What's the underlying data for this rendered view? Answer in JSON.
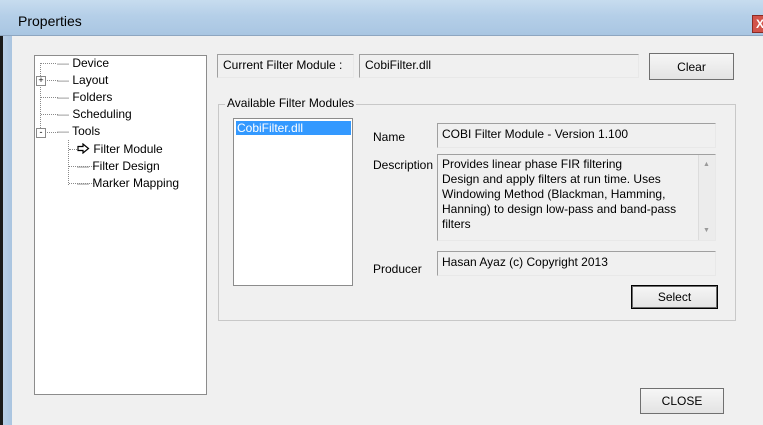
{
  "window": {
    "title": "Properties",
    "close_glyph": "X"
  },
  "tree": {
    "items": [
      {
        "label": "Device"
      },
      {
        "label": "Layout",
        "expander": "+"
      },
      {
        "label": "Folders"
      },
      {
        "label": "Scheduling"
      },
      {
        "label": "Tools",
        "expander": "-"
      },
      {
        "label": "Filter Module",
        "selected_marker": "arrow-right-icon"
      },
      {
        "label": "Filter Design"
      },
      {
        "label": "Marker Mapping"
      }
    ]
  },
  "current_filter": {
    "label": "Current Filter Module :",
    "value": "CobiFilter.dll",
    "clear_button": "Clear"
  },
  "available": {
    "group_title": "Available Filter Modules",
    "modules": [
      "CobiFilter.dll"
    ],
    "name_label": "Name",
    "name_value": "COBI Filter Module  - Version 1.100",
    "description_label": "Description",
    "description_lines": [
      "Provides linear phase FIR filtering",
      "Design and apply filters at run time. Uses",
      "Windowing Method (Blackman, Hamming,",
      "Hanning) to design low-pass and band-pass",
      "filters"
    ],
    "producer_label": "Producer",
    "producer_value": "Hasan Ayaz (c) Copyright 2013",
    "select_button": "Select"
  },
  "footer": {
    "close_button": "CLOSE"
  }
}
